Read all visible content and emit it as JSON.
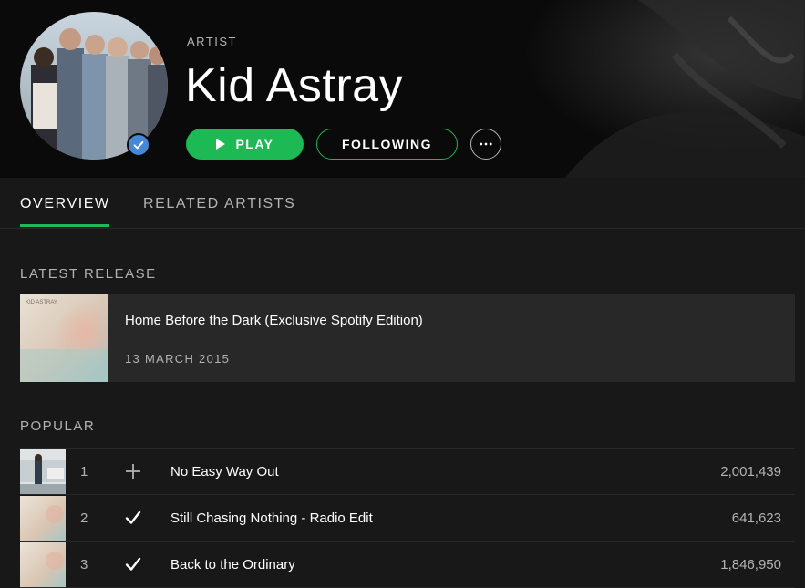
{
  "header": {
    "kicker": "ARTIST",
    "artist_name": "Kid Astray",
    "play_label": "PLAY",
    "following_label": "FOLLOWING",
    "verified": true
  },
  "tabs": [
    {
      "label": "OVERVIEW",
      "active": true
    },
    {
      "label": "RELATED ARTISTS",
      "active": false
    }
  ],
  "latest_release": {
    "section_title": "LATEST RELEASE",
    "title": "Home Before the Dark (Exclusive Spotify Edition)",
    "date": "13 MARCH 2015",
    "art_text": "KID ASTRAY"
  },
  "popular": {
    "section_title": "POPULAR",
    "tracks": [
      {
        "number": "1",
        "title": "No Easy Way Out",
        "plays": "2,001,439",
        "saved": false
      },
      {
        "number": "2",
        "title": "Still Chasing Nothing - Radio Edit",
        "plays": "641,623",
        "saved": true
      },
      {
        "number": "3",
        "title": "Back to the Ordinary",
        "plays": "1,846,950",
        "saved": true
      }
    ]
  },
  "colors": {
    "accent": "#1db954",
    "background": "#181818",
    "header_background": "#0a0a0a",
    "card": "#282828",
    "muted_text": "#b3b3b3",
    "verified_badge": "#4687d6"
  },
  "icons": {
    "play": "play-triangle-icon",
    "more": "ellipsis-icon",
    "verified": "checkmark-badge-icon",
    "add": "plus-icon",
    "saved": "checkmark-icon"
  }
}
